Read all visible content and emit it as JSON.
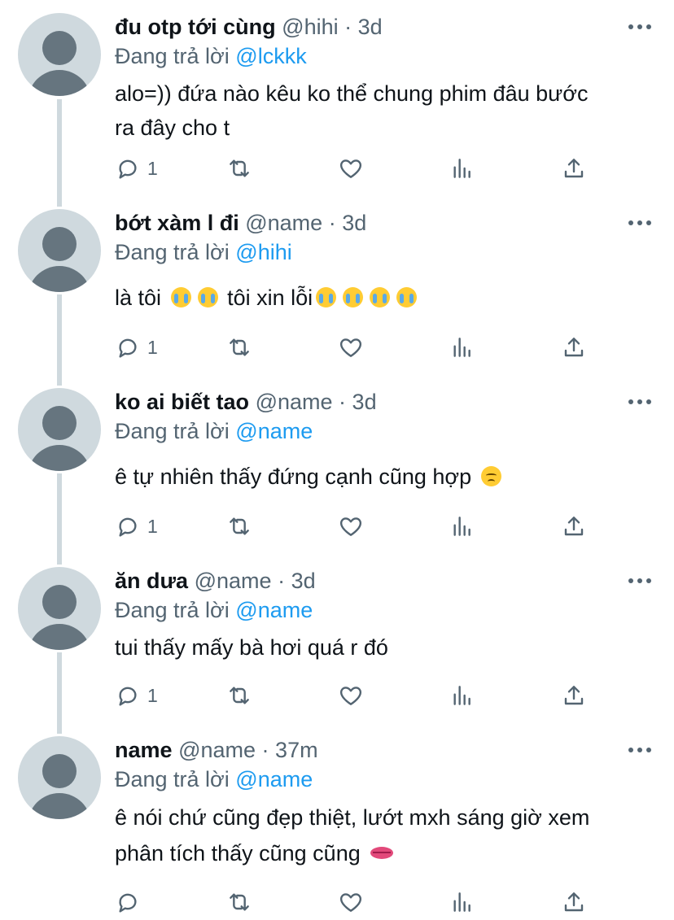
{
  "tweets": [
    {
      "display_name": "đu otp tới cùng",
      "handle": "@hihi",
      "separator": "·",
      "time": "3d",
      "replying_prefix": "Đang trả lời",
      "replying_to": "@lckkk",
      "text_lines": [
        "alo=)) đứa nào kêu ko thể chung phim đâu bước",
        "ra đây cho t"
      ],
      "reply_count": "1"
    },
    {
      "display_name": "bớt xàm l đi",
      "handle": "@name",
      "separator": "·",
      "time": "3d",
      "replying_prefix": "Đang trả lời",
      "replying_to": "@hihi",
      "text_a": "là tôi",
      "text_b": "tôi xin lỗi",
      "emoji_name": "loudly-crying-face-emoji",
      "reply_count": "1"
    },
    {
      "display_name": "ko ai biết tao",
      "handle": "@name",
      "separator": "·",
      "time": "3d",
      "replying_prefix": "Đang trả lời",
      "replying_to": "@name",
      "text": "ê tự nhiên thấy đứng cạnh cũng hợp",
      "emoji_name": "disappointed-face-emoji",
      "reply_count": "1"
    },
    {
      "display_name": "ăn dưa",
      "handle": "@name",
      "separator": "·",
      "time": "3d",
      "replying_prefix": "Đang trả lời",
      "replying_to": "@name",
      "text": "tui thấy mấy bà hơi quá r đó",
      "reply_count": "1"
    },
    {
      "display_name": "name",
      "handle": "@name",
      "separator": "·",
      "time": "37m",
      "replying_prefix": "Đang trả lời",
      "replying_to": "@name",
      "text_lines": [
        "ê nói chứ cũng đẹp thiệt, lướt mxh sáng giờ xem",
        "phân tích thấy cũng cũng"
      ],
      "emoji_name": "lips-emoji",
      "reply_count": ""
    }
  ],
  "colors": {
    "text": "#0f1419",
    "secondary": "#536471",
    "link": "#1d9bf0",
    "avatar_bg": "#cfd9de",
    "avatar_fg": "#66757f",
    "thread_line": "#cfd9de"
  },
  "icons": [
    "reply-icon",
    "retweet-icon",
    "like-icon",
    "views-icon",
    "share-icon",
    "more-icon"
  ]
}
